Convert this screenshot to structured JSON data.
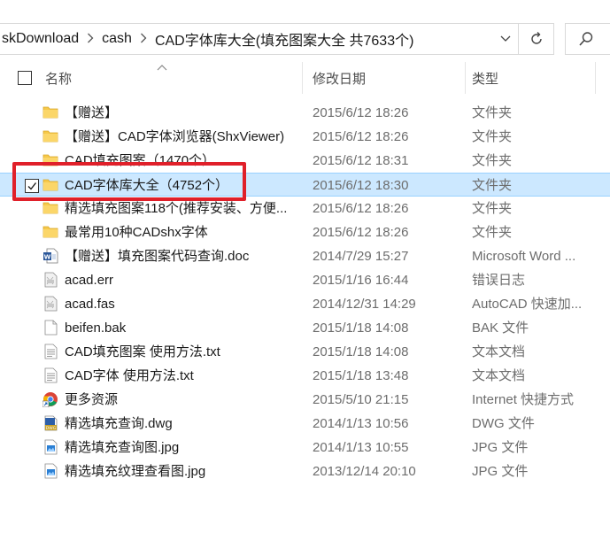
{
  "address": {
    "crumbs": [
      "skDownload",
      "cash",
      "CAD字体库大全(填充图案大全 共7633个)"
    ]
  },
  "header": {
    "name": "名称",
    "date": "修改日期",
    "type": "类型"
  },
  "rows": [
    {
      "name": "【赠送】",
      "date": "2015/6/12 18:26",
      "type": "文件夹",
      "icon": "folder-icon"
    },
    {
      "name": "【赠送】CAD字体浏览器(ShxViewer)",
      "date": "2015/6/12 18:26",
      "type": "文件夹",
      "icon": "folder-icon"
    },
    {
      "name": "CAD填充图案（1470个）",
      "date": "2015/6/12 18:31",
      "type": "文件夹",
      "icon": "folder-icon"
    },
    {
      "name": "CAD字体库大全（4752个）",
      "date": "2015/6/12 18:30",
      "type": "文件夹",
      "icon": "folder-icon",
      "selected": true
    },
    {
      "name": "精选填充图案118个(推荐安装、方便...",
      "date": "2015/6/12 18:26",
      "type": "文件夹",
      "icon": "folder-icon"
    },
    {
      "name": "最常用10种CADshx字体",
      "date": "2015/6/12 18:26",
      "type": "文件夹",
      "icon": "folder-icon"
    },
    {
      "name": "【赠送】填充图案代码查询.doc",
      "date": "2014/7/29 15:27",
      "type": "Microsoft Word ...",
      "icon": "word-doc-icon"
    },
    {
      "name": "acad.err",
      "date": "2015/1/16 16:44",
      "type": "错误日志",
      "icon": "generic-file-icon"
    },
    {
      "name": "acad.fas",
      "date": "2014/12/31 14:29",
      "type": "AutoCAD 快速加...",
      "icon": "generic-file-icon"
    },
    {
      "name": "beifen.bak",
      "date": "2015/1/18 14:08",
      "type": "BAK 文件",
      "icon": "blank-file-icon"
    },
    {
      "name": "CAD填充图案 使用方法.txt",
      "date": "2015/1/18 14:08",
      "type": "文本文档",
      "icon": "text-file-icon"
    },
    {
      "name": "CAD字体 使用方法.txt",
      "date": "2015/1/18 13:48",
      "type": "文本文档",
      "icon": "text-file-icon"
    },
    {
      "name": "更多资源",
      "date": "2015/5/10 21:15",
      "type": "Internet 快捷方式",
      "icon": "chrome-shortcut-icon"
    },
    {
      "name": "精选填充查询.dwg",
      "date": "2014/1/13 10:56",
      "type": "DWG 文件",
      "icon": "dwg-file-icon"
    },
    {
      "name": "精选填充查询图.jpg",
      "date": "2014/1/13 10:55",
      "type": "JPG 文件",
      "icon": "image-file-icon"
    },
    {
      "name": "精选填充纹理查看图.jpg",
      "date": "2013/12/14 20:10",
      "type": "JPG 文件",
      "icon": "image-file-icon"
    }
  ],
  "colors": {
    "selection_bg": "#cce8ff",
    "highlight_border": "#e0202a",
    "folder": "#f6c94a"
  }
}
